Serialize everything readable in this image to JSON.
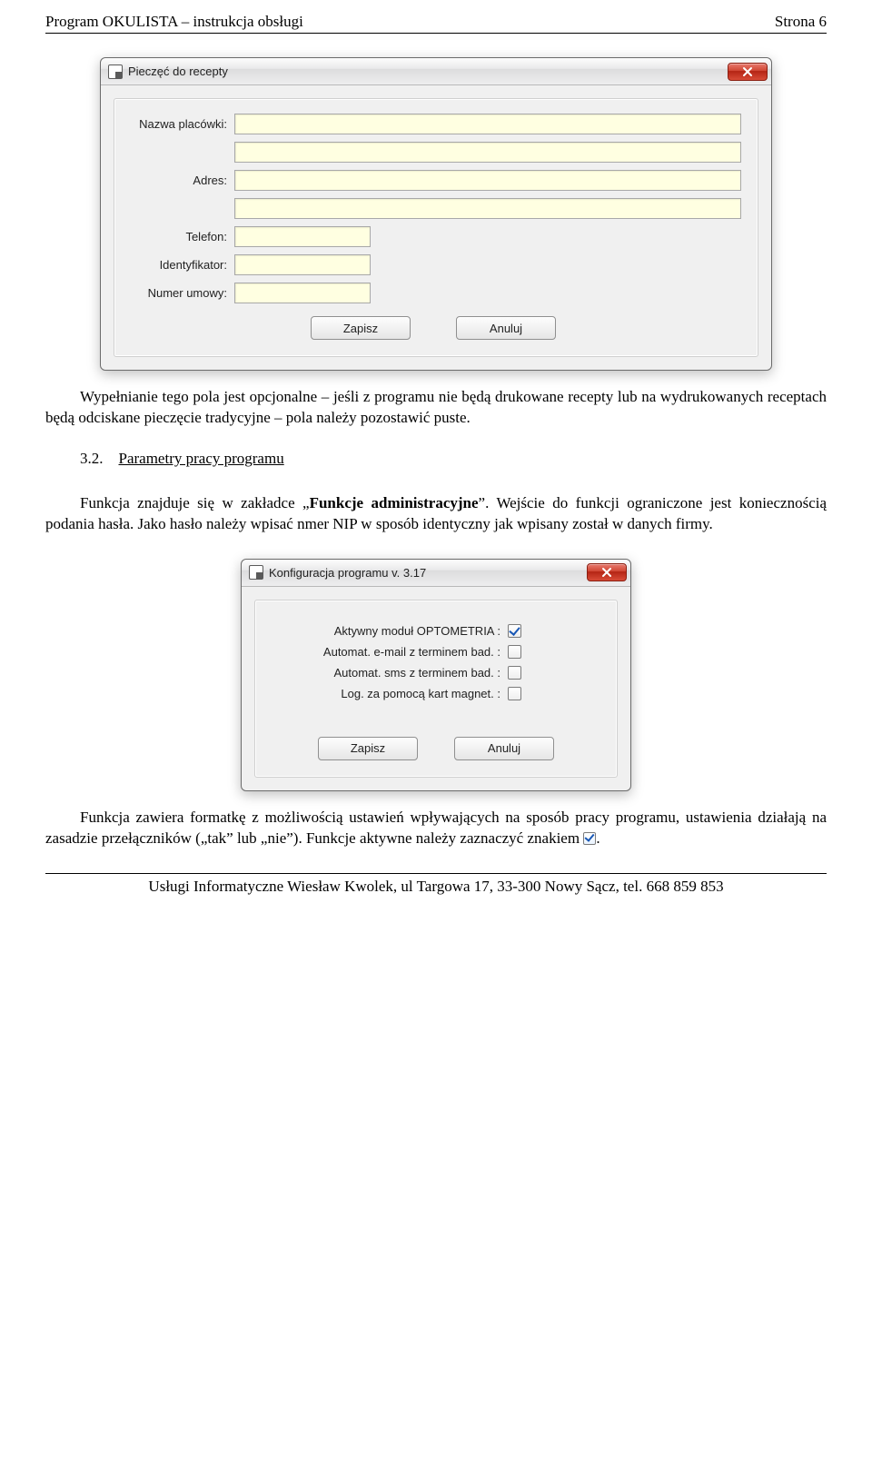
{
  "doc": {
    "header_left": "Program OKULISTA – instrukcja obsługi",
    "header_right": "Strona 6",
    "footer": "Usługi Informatyczne Wiesław Kwolek, ul Targowa 17, 33-300 Nowy Sącz, tel. 668 859 853"
  },
  "dialog1": {
    "title": "Pieczęć do recepty",
    "fields": {
      "nazwa_label": "Nazwa placówki:",
      "adres_label": "Adres:",
      "telefon_label": "Telefon:",
      "identyfikator_label": "Identyfikator:",
      "numer_umowy_label": "Numer umowy:"
    },
    "buttons": {
      "save": "Zapisz",
      "cancel": "Anuluj"
    }
  },
  "para1": "Wypełnianie tego pola jest opcjonalne – jeśli z programu nie będą drukowane recepty lub na wydrukowanych receptach będą odciskane pieczęcie tradycyjne – pola należy pozostawić puste.",
  "section": {
    "num": "3.2.",
    "title": "Parametry pracy programu"
  },
  "para2a": "Funkcja znajduje się w zakładce „",
  "para2b": "Funkcje administracyjne",
  "para2c": "”. Wejście do funkcji ograniczone jest koniecznością podania hasła. Jako hasło należy wpisać nmer NIP w sposób identyczny jak wpisany został w danych firmy.",
  "dialog2": {
    "title": "Konfiguracja programu v. 3.17",
    "options": {
      "opt1": "Aktywny moduł OPTOMETRIA  :",
      "opt2": "Automat. e-mail z terminem bad.  :",
      "opt3": "Automat. sms z terminem bad.  :",
      "opt4": "Log. za pomocą kart magnet.  :"
    },
    "buttons": {
      "save": "Zapisz",
      "cancel": "Anuluj"
    }
  },
  "para3a": "Funkcja zawiera formatkę z możliwością ustawień wpływających na sposób pracy programu, ustawienia działają na zasadzie przełączników („tak” lub „nie”). Funkcje aktywne należy zaznaczyć znakiem ",
  "para3b": "."
}
